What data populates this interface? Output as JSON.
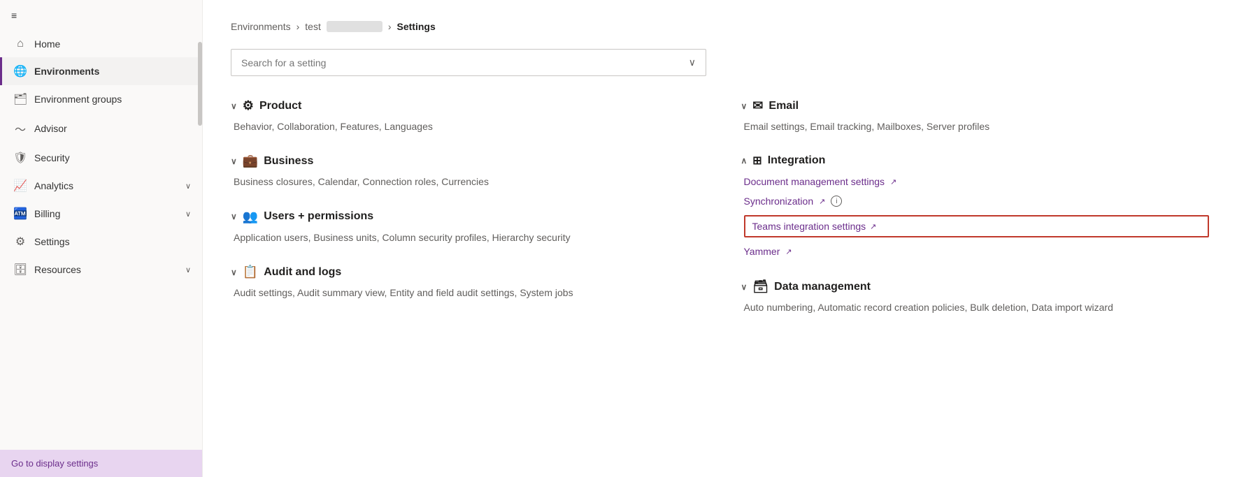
{
  "sidebar": {
    "hamburger_label": "≡",
    "items": [
      {
        "id": "home",
        "icon": "⌂",
        "label": "Home",
        "active": false,
        "has_chevron": false
      },
      {
        "id": "environments",
        "icon": "🌐",
        "label": "Environments",
        "active": true,
        "has_chevron": false
      },
      {
        "id": "environment-groups",
        "icon": "🗂",
        "label": "Environment groups",
        "active": false,
        "has_chevron": false
      },
      {
        "id": "advisor",
        "icon": "📈",
        "label": "Advisor",
        "active": false,
        "has_chevron": false
      },
      {
        "id": "security",
        "icon": "🛡",
        "label": "Security",
        "active": false,
        "has_chevron": false
      },
      {
        "id": "analytics",
        "icon": "📊",
        "label": "Analytics",
        "active": false,
        "has_chevron": true
      },
      {
        "id": "billing",
        "icon": "🏧",
        "label": "Billing",
        "active": false,
        "has_chevron": true
      },
      {
        "id": "settings",
        "icon": "⚙",
        "label": "Settings",
        "active": false,
        "has_chevron": false
      },
      {
        "id": "resources",
        "icon": "🗄",
        "label": "Resources",
        "active": false,
        "has_chevron": true
      }
    ],
    "bottom_item": "Go to display settings"
  },
  "breadcrumb": {
    "environments_label": "Environments",
    "test_label": "test",
    "settings_label": "Settings"
  },
  "search": {
    "placeholder": "Search for a setting"
  },
  "left_sections": [
    {
      "id": "product",
      "icon": "⚙",
      "title": "Product",
      "links_text": "Behavior, Collaboration, Features, Languages"
    },
    {
      "id": "business",
      "icon": "💼",
      "title": "Business",
      "links_text": "Business closures, Calendar, Connection roles, Currencies"
    },
    {
      "id": "users-permissions",
      "icon": "👥",
      "title": "Users + permissions",
      "links_text": "Application users, Business units, Column security profiles, Hierarchy security"
    },
    {
      "id": "audit-logs",
      "icon": "📋",
      "title": "Audit and logs",
      "links_text": "Audit settings, Audit summary view, Entity and field audit settings, System jobs"
    }
  ],
  "right_sections": [
    {
      "id": "email",
      "icon": "✉",
      "title": "Email",
      "links_text": "Email settings, Email tracking, Mailboxes, Server profiles",
      "type": "plain"
    },
    {
      "id": "integration",
      "icon": "⊞",
      "title": "Integration",
      "type": "integration",
      "sub_items": [
        {
          "id": "doc-mgmt",
          "label": "Document management settings",
          "highlighted": false,
          "has_external": true,
          "has_info": false
        },
        {
          "id": "sync",
          "label": "Synchronization",
          "highlighted": false,
          "has_external": true,
          "has_info": true
        },
        {
          "id": "teams",
          "label": "Teams integration settings",
          "highlighted": true,
          "has_external": true,
          "has_info": false
        },
        {
          "id": "yammer",
          "label": "Yammer",
          "highlighted": false,
          "has_external": true,
          "has_info": false
        }
      ]
    },
    {
      "id": "data-management",
      "icon": "🗃",
      "title": "Data management",
      "links_text": "Auto numbering, Automatic record creation policies, Bulk deletion, Data import wizard",
      "type": "plain"
    }
  ]
}
